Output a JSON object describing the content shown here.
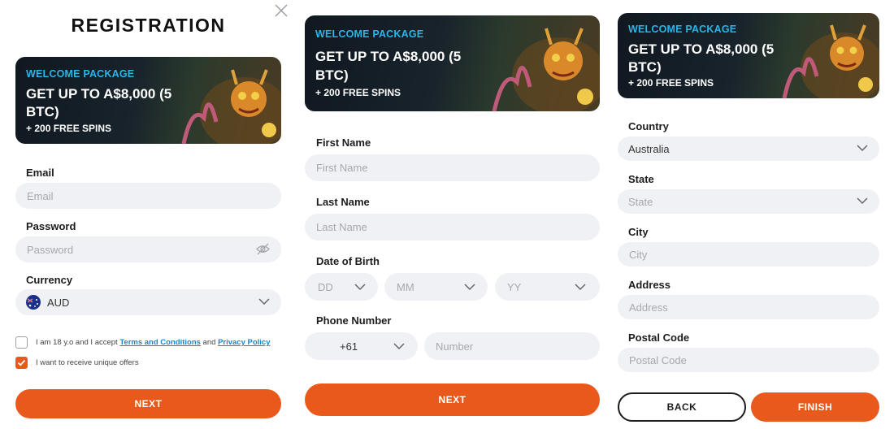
{
  "colors": {
    "accent": "#e9591b",
    "field_bg": "#f0f1f4",
    "banner_tag": "#27b6e8",
    "link": "#1a86c8"
  },
  "banner": {
    "tag": "WELCOME PACKAGE",
    "headline_line1": "GET UP TO A$8,000 (5",
    "headline_line2": "BTC)",
    "sub": "+ 200 FREE SPINS"
  },
  "step1": {
    "title": "REGISTRATION",
    "close_icon": "close-icon",
    "email": {
      "label": "Email",
      "placeholder": "Email"
    },
    "password": {
      "label": "Password",
      "placeholder": "Password",
      "icon": "eye-icon"
    },
    "currency": {
      "label": "Currency",
      "value": "AUD",
      "flag": "australia-flag-icon"
    },
    "terms": {
      "checked": false,
      "text_before": "I am 18 y.o and I accept ",
      "terms_link": "Terms and Conditions",
      "text_mid": " and ",
      "privacy_link": "Privacy Policy"
    },
    "offers": {
      "checked": true,
      "text": "I want to receive unique offers"
    },
    "next_label": "NEXT"
  },
  "step2": {
    "first_name": {
      "label": "First Name",
      "placeholder": "First Name"
    },
    "last_name": {
      "label": "Last Name",
      "placeholder": "Last Name"
    },
    "dob": {
      "label": "Date of Birth",
      "day": "DD",
      "month": "MM",
      "year": "YY"
    },
    "phone": {
      "label": "Phone Number",
      "code": "+61",
      "placeholder": "Number"
    },
    "next_label": "NEXT"
  },
  "step3": {
    "country": {
      "label": "Country",
      "value": "Australia"
    },
    "state": {
      "label": "State",
      "placeholder": "State"
    },
    "city": {
      "label": "City",
      "placeholder": "City"
    },
    "address": {
      "label": "Address",
      "placeholder": "Address"
    },
    "postal": {
      "label": "Postal Code",
      "placeholder": "Postal Code"
    },
    "back_label": "BACK",
    "finish_label": "FINISH"
  }
}
